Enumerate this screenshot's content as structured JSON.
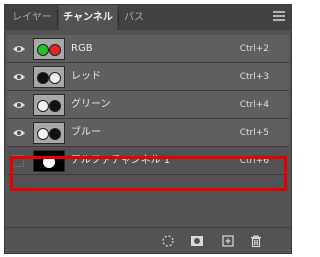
{
  "tabs": [
    {
      "label": "レイヤー",
      "active": false
    },
    {
      "label": "チャンネル",
      "active": true
    },
    {
      "label": "パス",
      "active": false
    }
  ],
  "channels": [
    {
      "name": "RGB",
      "shortcut": "Ctrl+2",
      "visible": true,
      "thumb": "rgb"
    },
    {
      "name": "レッド",
      "shortcut": "Ctrl+3",
      "visible": true,
      "thumb": "gray"
    },
    {
      "name": "グリーン",
      "shortcut": "Ctrl+4",
      "visible": true,
      "thumb": "gray-b"
    },
    {
      "name": "ブルー",
      "shortcut": "Ctrl+5",
      "visible": true,
      "thumb": "gray-b"
    },
    {
      "name": "アルファチャンネル 1",
      "shortcut": "Ctrl+6",
      "visible": false,
      "thumb": "alpha"
    }
  ],
  "footer_icons": [
    "load-selection-icon",
    "save-selection-icon",
    "new-channel-icon",
    "delete-channel-icon"
  ],
  "colors": {
    "highlight": "#e60000",
    "panel": "#535353"
  }
}
